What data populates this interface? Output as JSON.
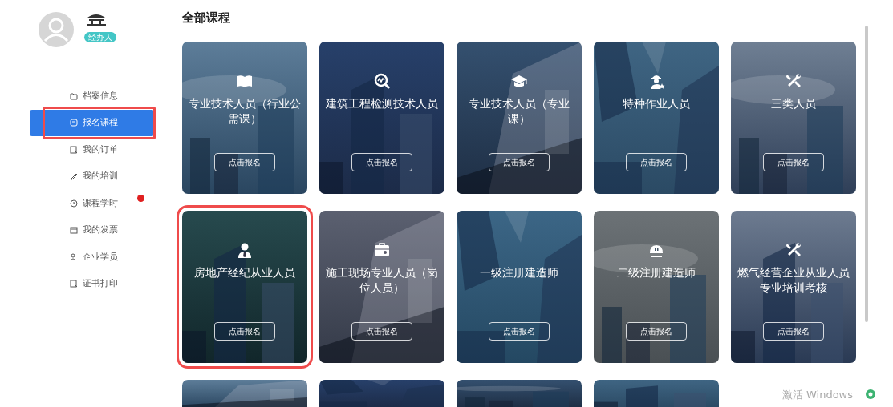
{
  "profile": {
    "role_badge": "经办人"
  },
  "sidebar": {
    "items": [
      {
        "label": "档案信息",
        "selected": false,
        "highlighted": false,
        "badge": false
      },
      {
        "label": "报名课程",
        "selected": true,
        "highlighted": true,
        "badge": false
      },
      {
        "label": "我的订单",
        "selected": false,
        "highlighted": false,
        "badge": false
      },
      {
        "label": "我的培训",
        "selected": false,
        "highlighted": false,
        "badge": false
      },
      {
        "label": "课程学时",
        "selected": false,
        "highlighted": false,
        "badge": true
      },
      {
        "label": "我的发票",
        "selected": false,
        "highlighted": false,
        "badge": false
      },
      {
        "label": "企业学员",
        "selected": false,
        "highlighted": false,
        "badge": false
      },
      {
        "label": "证书打印",
        "selected": false,
        "highlighted": false,
        "badge": false
      }
    ]
  },
  "main": {
    "title": "全部课程",
    "courses": [
      {
        "kind": "course",
        "title": "专业技术人员（行业公需课）",
        "button": "点击报名",
        "highlighted": false
      },
      {
        "kind": "course",
        "title": "建筑工程检测技术人员",
        "button": "点击报名",
        "highlighted": false
      },
      {
        "kind": "course",
        "title": "专业技术人员（专业课）",
        "button": "点击报名",
        "highlighted": false
      },
      {
        "kind": "course",
        "title": "特种作业人员",
        "button": "点击报名",
        "highlighted": false
      },
      {
        "kind": "course",
        "title": "三类人员",
        "button": "点击报名",
        "highlighted": false
      },
      {
        "kind": "course",
        "title": "房地产经纪从业人员",
        "button": "点击报名",
        "highlighted": true
      },
      {
        "kind": "course",
        "title": "施工现场专业人员（岗位人员）",
        "button": "点击报名",
        "highlighted": false
      },
      {
        "kind": "course",
        "title": "一级注册建造师",
        "button": "点击报名",
        "highlighted": false
      },
      {
        "kind": "course",
        "title": "二级注册建造师",
        "button": "点击报名",
        "highlighted": false
      },
      {
        "kind": "course",
        "title": "燃气经营企业从业人员专业培训考核",
        "button": "点击报名",
        "highlighted": false
      },
      {
        "kind": "picture"
      },
      {
        "kind": "picture"
      },
      {
        "kind": "picture"
      },
      {
        "kind": "picture"
      }
    ]
  },
  "system_notice": "激活 Windows"
}
